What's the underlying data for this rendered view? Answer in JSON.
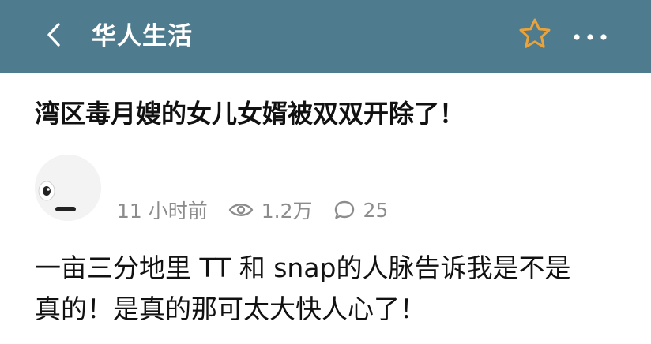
{
  "header": {
    "title": "华人生活",
    "back_icon": "chevron-left-icon",
    "star_icon": "star-outline-icon",
    "more_icon": "more-horizontal-icon",
    "star_color": "#e8a33d",
    "bar_color": "#4e7b8e"
  },
  "post": {
    "title": "湾区毒月嫂的女儿女婿被双双开除了！",
    "time_ago": "11 小时前",
    "views": "1.2万",
    "comments": "25",
    "body_line1": "一亩三分地里 TT 和 snap的人脉告诉我是不是",
    "body_line2": "真的！是真的那可太大快人心了！"
  }
}
